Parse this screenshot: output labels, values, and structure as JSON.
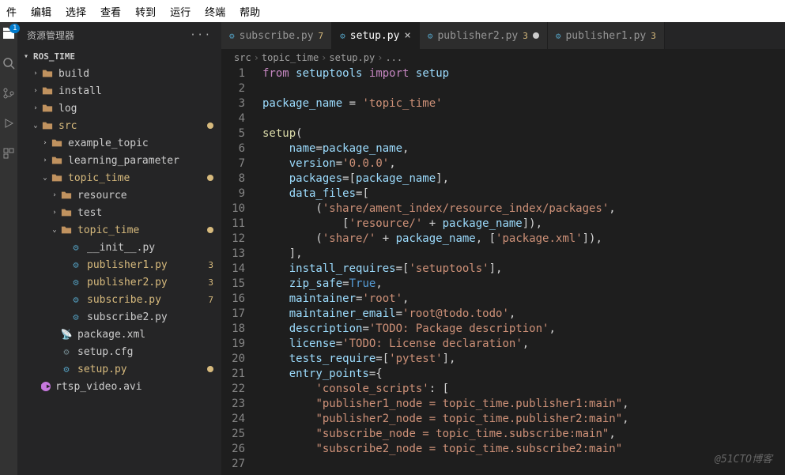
{
  "menu": [
    "件",
    "编辑",
    "选择",
    "查看",
    "转到",
    "运行",
    "终端",
    "帮助"
  ],
  "activity_badge": "1",
  "sidebar": {
    "title": "资源管理器",
    "root": "ROS_TIME",
    "tree": [
      {
        "depth": 1,
        "kind": "folder",
        "open": false,
        "label": "build"
      },
      {
        "depth": 1,
        "kind": "folder",
        "open": false,
        "label": "install"
      },
      {
        "depth": 1,
        "kind": "folder",
        "open": false,
        "label": "log"
      },
      {
        "depth": 1,
        "kind": "folder",
        "open": true,
        "label": "src",
        "mod": true,
        "orange": true
      },
      {
        "depth": 2,
        "kind": "folder",
        "open": false,
        "label": "example_topic"
      },
      {
        "depth": 2,
        "kind": "folder",
        "open": false,
        "label": "learning_parameter"
      },
      {
        "depth": 2,
        "kind": "folder",
        "open": true,
        "label": "topic_time",
        "mod": true,
        "orange": true
      },
      {
        "depth": 3,
        "kind": "folder",
        "open": false,
        "label": "resource"
      },
      {
        "depth": 3,
        "kind": "folder",
        "open": false,
        "label": "test"
      },
      {
        "depth": 3,
        "kind": "folder",
        "open": true,
        "label": "topic_time",
        "mod": true,
        "orange": true
      },
      {
        "depth": 4,
        "kind": "py",
        "label": "__init__.py"
      },
      {
        "depth": 4,
        "kind": "py",
        "label": "publisher1.py",
        "badge": "3",
        "orange": true
      },
      {
        "depth": 4,
        "kind": "py",
        "label": "publisher2.py",
        "badge": "3",
        "orange": true
      },
      {
        "depth": 4,
        "kind": "py",
        "label": "subscribe.py",
        "badge": "7",
        "orange": true
      },
      {
        "depth": 4,
        "kind": "py",
        "label": "subscribe2.py"
      },
      {
        "depth": 3,
        "kind": "xml",
        "label": "package.xml"
      },
      {
        "depth": 3,
        "kind": "cfg",
        "label": "setup.cfg"
      },
      {
        "depth": 3,
        "kind": "py",
        "label": "setup.py",
        "mod": true,
        "orange": true
      },
      {
        "depth": 1,
        "kind": "avi",
        "label": "rtsp_video.avi"
      }
    ]
  },
  "tabs": [
    {
      "label": "subscribe.py",
      "badge": "7",
      "active": false,
      "mod": false
    },
    {
      "label": "setup.py",
      "badge": "",
      "active": true,
      "mod": false,
      "close": true
    },
    {
      "label": "publisher2.py",
      "badge": "3",
      "active": false,
      "mod": true
    },
    {
      "label": "publisher1.py",
      "badge": "3",
      "active": false,
      "mod": false
    }
  ],
  "breadcrumbs": [
    "src",
    "topic_time",
    "setup.py",
    "..."
  ],
  "code": [
    [
      [
        "k",
        "from"
      ],
      [
        "ws",
        " "
      ],
      [
        "n",
        "setuptools"
      ],
      [
        "ws",
        " "
      ],
      [
        "k",
        "import"
      ],
      [
        "ws",
        " "
      ],
      [
        "n",
        "setup"
      ]
    ],
    [],
    [
      [
        "n",
        "package_name"
      ],
      [
        "p",
        " = "
      ],
      [
        "s",
        "'topic_time'"
      ]
    ],
    [],
    [
      [
        "f",
        "setup"
      ],
      [
        "p",
        "("
      ]
    ],
    [
      [
        "p",
        "    "
      ],
      [
        "n",
        "name"
      ],
      [
        "p",
        "="
      ],
      [
        "n",
        "package_name"
      ],
      [
        "p",
        ","
      ]
    ],
    [
      [
        "p",
        "    "
      ],
      [
        "n",
        "version"
      ],
      [
        "p",
        "="
      ],
      [
        "s",
        "'0.0.0'"
      ],
      [
        "p",
        ","
      ]
    ],
    [
      [
        "p",
        "    "
      ],
      [
        "n",
        "packages"
      ],
      [
        "p",
        "=["
      ],
      [
        "n",
        "package_name"
      ],
      [
        "p",
        "],"
      ]
    ],
    [
      [
        "p",
        "    "
      ],
      [
        "n",
        "data_files"
      ],
      [
        "p",
        "=["
      ]
    ],
    [
      [
        "p",
        "        ("
      ],
      [
        "s",
        "'share/ament_index/resource_index/packages'"
      ],
      [
        "p",
        ","
      ]
    ],
    [
      [
        "p",
        "            ["
      ],
      [
        "s",
        "'resource/'"
      ],
      [
        "p",
        " + "
      ],
      [
        "n",
        "package_name"
      ],
      [
        "p",
        "]),"
      ]
    ],
    [
      [
        "p",
        "        ("
      ],
      [
        "s",
        "'share/'"
      ],
      [
        "p",
        " + "
      ],
      [
        "n",
        "package_name"
      ],
      [
        "p",
        ", ["
      ],
      [
        "s",
        "'package.xml'"
      ],
      [
        "p",
        "]),"
      ]
    ],
    [
      [
        "p",
        "    ],"
      ]
    ],
    [
      [
        "p",
        "    "
      ],
      [
        "n",
        "install_requires"
      ],
      [
        "p",
        "=["
      ],
      [
        "s",
        "'setuptools'"
      ],
      [
        "p",
        "],"
      ]
    ],
    [
      [
        "p",
        "    "
      ],
      [
        "n",
        "zip_safe"
      ],
      [
        "p",
        "="
      ],
      [
        "c1",
        "True"
      ],
      [
        "p",
        ","
      ]
    ],
    [
      [
        "p",
        "    "
      ],
      [
        "n",
        "maintainer"
      ],
      [
        "p",
        "="
      ],
      [
        "s",
        "'root'"
      ],
      [
        "p",
        ","
      ]
    ],
    [
      [
        "p",
        "    "
      ],
      [
        "n",
        "maintainer_email"
      ],
      [
        "p",
        "="
      ],
      [
        "s",
        "'root@todo.todo'"
      ],
      [
        "p",
        ","
      ]
    ],
    [
      [
        "p",
        "    "
      ],
      [
        "n",
        "description"
      ],
      [
        "p",
        "="
      ],
      [
        "s",
        "'TODO: Package description'"
      ],
      [
        "p",
        ","
      ]
    ],
    [
      [
        "p",
        "    "
      ],
      [
        "n",
        "license"
      ],
      [
        "p",
        "="
      ],
      [
        "s",
        "'TODO: License declaration'"
      ],
      [
        "p",
        ","
      ]
    ],
    [
      [
        "p",
        "    "
      ],
      [
        "n",
        "tests_require"
      ],
      [
        "p",
        "=["
      ],
      [
        "s",
        "'pytest'"
      ],
      [
        "p",
        "],"
      ]
    ],
    [
      [
        "p",
        "    "
      ],
      [
        "n",
        "entry_points"
      ],
      [
        "p",
        "={"
      ]
    ],
    [
      [
        "p",
        "        "
      ],
      [
        "s",
        "'console_scripts'"
      ],
      [
        "p",
        ": ["
      ]
    ],
    [
      [
        "p",
        "        "
      ],
      [
        "s",
        "\"publisher1_node = topic_time.publisher1:main\""
      ],
      [
        "p",
        ","
      ]
    ],
    [
      [
        "p",
        "        "
      ],
      [
        "s",
        "\"publisher2_node = topic_time.publisher2:main\""
      ],
      [
        "p",
        ","
      ]
    ],
    [
      [
        "p",
        "        "
      ],
      [
        "s",
        "\"subscribe_node = topic_time.subscribe:main\""
      ],
      [
        "p",
        ","
      ]
    ],
    [
      [
        "p",
        "        "
      ],
      [
        "s",
        "\"subscribe2_node = topic_time.subscribe2:main\""
      ]
    ],
    []
  ],
  "watermark": "@51CTO博客",
  "chart_data": null
}
